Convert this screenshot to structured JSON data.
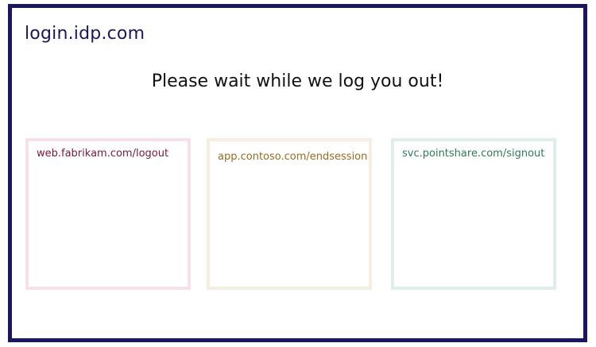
{
  "page": {
    "host": "login.idp.com",
    "message": "Please wait while we log you out!"
  },
  "frames": [
    {
      "url": "web.fabrikam.com/logout",
      "border_color": "#f5e1e6",
      "text_color": "#7a1838"
    },
    {
      "url": "app.contoso.com/endsession",
      "border_color": "#f4ede0",
      "text_color": "#9a6a1e"
    },
    {
      "url": "svc.pointshare.com/signout",
      "border_color": "#dfeee9",
      "text_color": "#2e7b55"
    }
  ],
  "colors": {
    "frame_border": "#1b1660",
    "host_text": "#1b1660"
  }
}
